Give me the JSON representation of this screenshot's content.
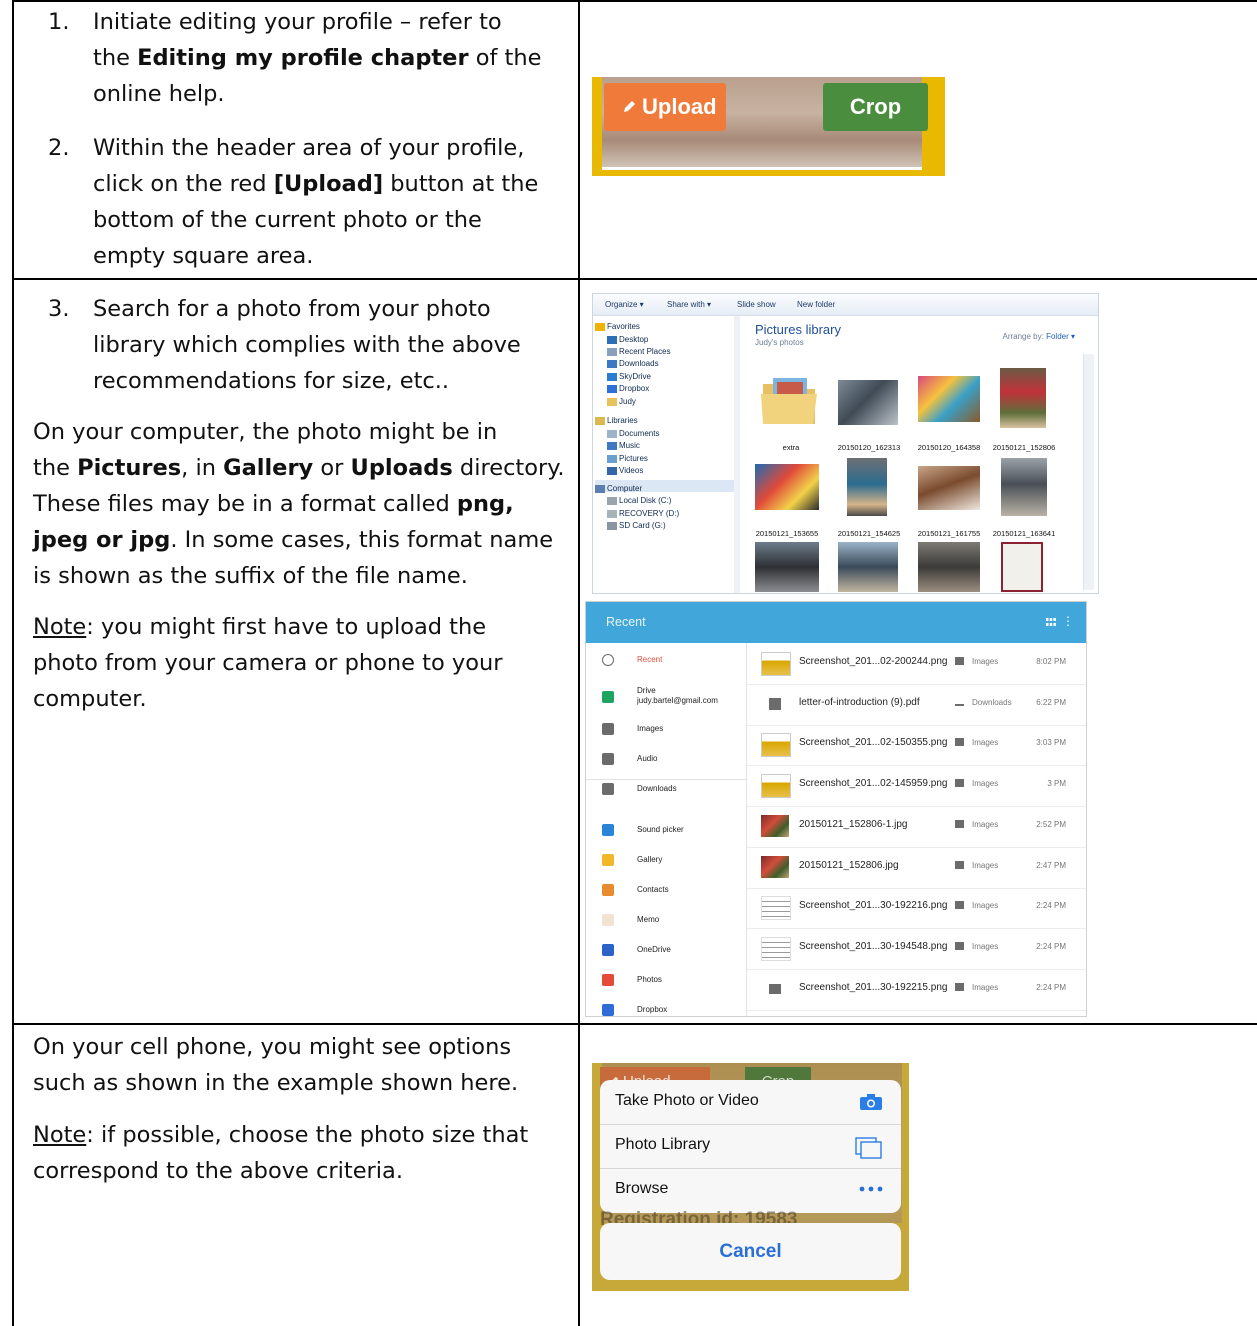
{
  "row1": {
    "step1_num": "1.",
    "step1_a": "Initiate editing your profile – refer to",
    "step1_b_pre": "the ",
    "step1_b_bold": "Editing my profile chapter",
    "step1_b_post": " of the",
    "step1_c": "online help.",
    "step2_num": "2.",
    "step2_a": "Within the header area of your profile,",
    "step2_b_pre": "click on the red ",
    "step2_b_bold": "[Upload]",
    "step2_b_post": " button at the",
    "step2_c": "bottom of the current photo or the",
    "step2_d": "empty square area.",
    "shot": {
      "upload_label": "Upload",
      "crop_label": "Crop",
      "upload_color": "#f07a3a",
      "crop_color": "#4b8d3e",
      "bg_color": "#e9b800"
    }
  },
  "row2": {
    "step3_num": "3.",
    "step3_a": "Search for a photo from your photo",
    "step3_b": "library which complies with the above",
    "step3_c": "recommendations for size, etc..",
    "para1": {
      "l1": "On your computer, the photo might be in",
      "l2_pre": "the ",
      "l2_b1": "Pictures",
      "l2_mid1": ", in ",
      "l2_b2": "Gallery",
      "l2_mid2": " or ",
      "l2_b3": "Uploads",
      "l2_post": " directory.",
      "l3_pre": "These files may be in a format called ",
      "l3_b": "png,",
      "l4_b": "jpeg or jpg",
      "l4_post": ".  In some cases, this format name",
      "l5": "is shown as the suffix of the file name."
    },
    "para2": {
      "note": "Note",
      "l1_post": ": you might first have to upload the",
      "l2": "photo from your camera or phone to your",
      "l3": "computer."
    },
    "explorer": {
      "toolbar": [
        "Organize ▾",
        "Share with ▾",
        "Slide show",
        "New folder"
      ],
      "nav": [
        {
          "label": "Favorites",
          "icon": "star-icon",
          "header": true
        },
        {
          "label": "Desktop",
          "icon": "desktop-icon"
        },
        {
          "label": "Recent Places",
          "icon": "recent-places-icon"
        },
        {
          "label": "Downloads",
          "icon": "downloads-folder-icon"
        },
        {
          "label": "SkyDrive",
          "icon": "skydrive-icon"
        },
        {
          "label": "Dropbox",
          "icon": "dropbox-icon"
        },
        {
          "label": "Judy",
          "icon": "folder-icon"
        },
        {
          "label": "Libraries",
          "icon": "libraries-icon",
          "header": true
        },
        {
          "label": "Documents",
          "icon": "documents-icon"
        },
        {
          "label": "Music",
          "icon": "music-icon"
        },
        {
          "label": "Pictures",
          "icon": "pictures-icon"
        },
        {
          "label": "Videos",
          "icon": "videos-icon"
        },
        {
          "label": "Computer",
          "icon": "computer-icon",
          "header": true
        },
        {
          "label": "Local Disk (C:)",
          "icon": "disk-icon"
        },
        {
          "label": "RECOVERY (D:)",
          "icon": "drive-icon"
        },
        {
          "label": "SD Card (G:)",
          "icon": "sdcard-icon"
        }
      ],
      "title": "Pictures library",
      "subtitle": "Judy's photos",
      "arrange_label": "Arrange by:",
      "arrange_value": "Folder ▾",
      "captions": [
        "extra",
        "20150120_162313",
        "20150120_164358",
        "20150121_152806",
        "20150121_153655",
        "20150121_154625",
        "20150121_161755",
        "20150121_163641"
      ]
    },
    "picker": {
      "title": "Recent",
      "accent": "#41a6d9",
      "side": [
        {
          "label": "Recent",
          "icon": "clock-icon"
        },
        {
          "label": "Drive",
          "sub": "judy.bartel@gmail.com",
          "icon": "drive-icon"
        },
        {
          "label": "Images",
          "icon": "image-icon"
        },
        {
          "label": "Audio",
          "icon": "audio-icon"
        },
        {
          "label": "Downloads",
          "icon": "download-icon"
        },
        {
          "label": "Sound picker",
          "icon": "sound-picker-icon"
        },
        {
          "label": "Gallery",
          "icon": "gallery-icon"
        },
        {
          "label": "Contacts",
          "icon": "contacts-icon"
        },
        {
          "label": "Memo",
          "icon": "memo-icon"
        },
        {
          "label": "OneDrive",
          "icon": "onedrive-icon"
        },
        {
          "label": "Photos",
          "icon": "photos-icon"
        },
        {
          "label": "Dropbox",
          "icon": "dropbox-icon"
        }
      ],
      "rows": [
        {
          "name": "Screenshot_201...02-200244.png",
          "cat": "Images",
          "time": "8:02 PM"
        },
        {
          "name": "letter-of-introduction (9).pdf",
          "cat": "Downloads",
          "time": "6:22 PM"
        },
        {
          "name": "Screenshot_201...02-150355.png",
          "cat": "Images",
          "time": "3:03 PM"
        },
        {
          "name": "Screenshot_201...02-145959.png",
          "cat": "Images",
          "time": "3 PM"
        },
        {
          "name": "20150121_152806-1.jpg",
          "cat": "Images",
          "time": "2:52 PM"
        },
        {
          "name": "20150121_152806.jpg",
          "cat": "Images",
          "time": "2:47 PM"
        },
        {
          "name": "Screenshot_201...30-192216.png",
          "cat": "Images",
          "time": "2:24 PM"
        },
        {
          "name": "Screenshot_201...30-194548.png",
          "cat": "Images",
          "time": "2:24 PM"
        },
        {
          "name": "Screenshot_201...30-192215.png",
          "cat": "Images",
          "time": "2:24 PM"
        }
      ]
    }
  },
  "row3": {
    "l1": "On your cell phone, you might see options",
    "l2": "such as shown in the example shown here.",
    "note": "Note",
    "l3_post": ": if possible, choose the photo size that",
    "l4": "correspond to the above criteria.",
    "sheet": {
      "upload_label": "Upload",
      "crop_label": "Crop",
      "options": [
        {
          "label": "Take Photo or Video",
          "icon": "camera-icon"
        },
        {
          "label": "Photo Library",
          "icon": "photo-library-icon"
        },
        {
          "label": "Browse",
          "icon": "more-icon"
        }
      ],
      "behind_text": "Registration id: 19583",
      "cancel_label": "Cancel",
      "ios_blue": "#2a6fd6"
    }
  }
}
